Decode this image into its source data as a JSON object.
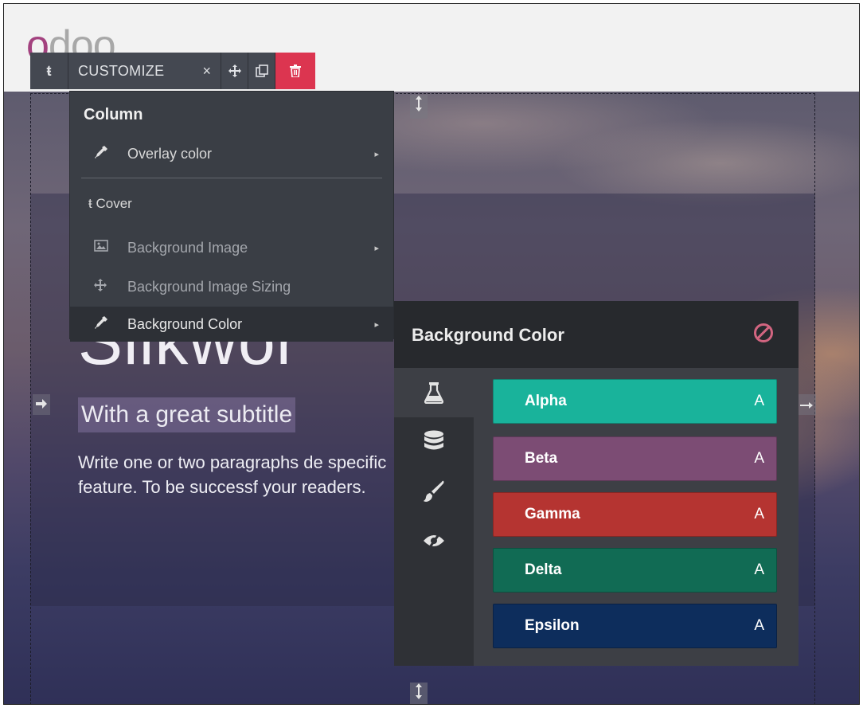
{
  "logo": {
    "text_o": "o",
    "text_rest": "doo"
  },
  "toolbar": {
    "parent_icon": "ŧ",
    "customize_label": "CUSTOMIZE",
    "customize_close": "×",
    "move_icon": "✥",
    "clone_icon": "⧉",
    "remove_icon": "🗑"
  },
  "menu": {
    "section_label": "Column",
    "overlay_color": "Overlay color",
    "cover_icon": "ŧ",
    "cover_label": "Cover",
    "bg_image": "Background Image",
    "bg_image_sizing": "Background Image Sizing",
    "bg_color": "Background Color"
  },
  "hero": {
    "title": "Silkwor",
    "subtitle": "With a great subtitle",
    "paragraph": "Write one or two paragraphs de specific feature. To be successf your readers."
  },
  "color_panel": {
    "title": "Background Color",
    "tabs": [
      "theme-colors",
      "database-colors",
      "custom-colors",
      "transparent"
    ],
    "swatches": [
      {
        "name": "Alpha",
        "sample": "A",
        "color": "#19b39b"
      },
      {
        "name": "Beta",
        "sample": "A",
        "color": "#7c4c74"
      },
      {
        "name": "Gamma",
        "sample": "A",
        "color": "#b53431"
      },
      {
        "name": "Delta",
        "sample": "A",
        "color": "#116b54"
      },
      {
        "name": "Epsilon",
        "sample": "A",
        "color": "#0d2d5c"
      }
    ]
  },
  "colors": {
    "accent_remove": "#dc3550",
    "toolbar_bg": "#444851",
    "menu_bg": "#3a3e45"
  }
}
